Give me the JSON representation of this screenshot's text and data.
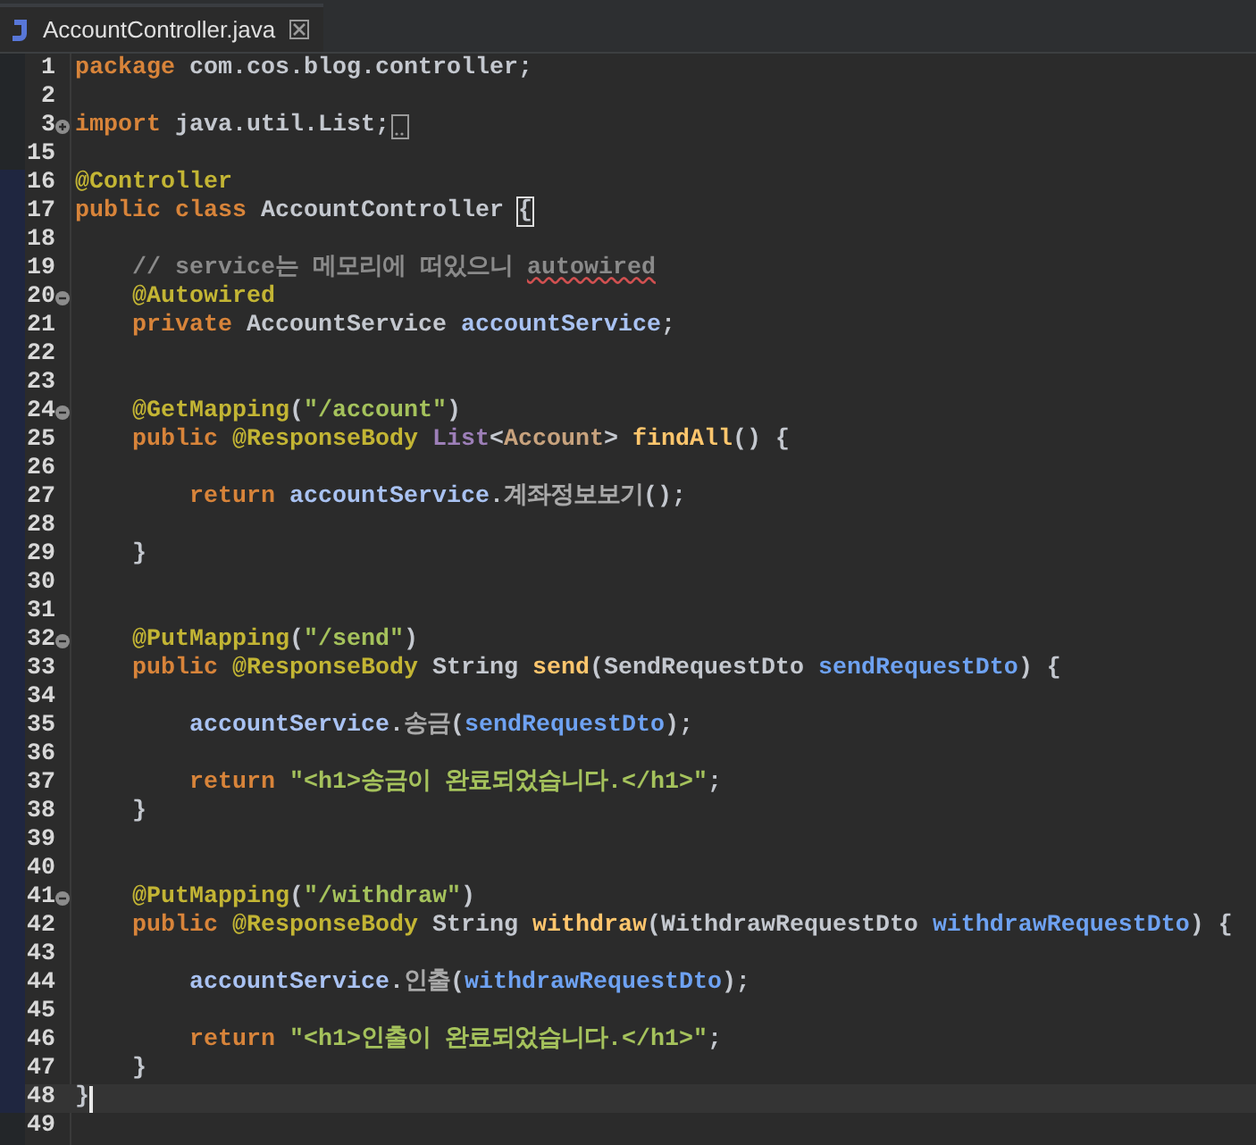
{
  "tab": {
    "title": "AccountController.java",
    "selected": true
  },
  "lines": [
    {
      "number": "1",
      "changed": false,
      "current": false,
      "tokens": [
        {
          "kind": "keyword",
          "text": "package"
        },
        {
          "kind": "plain",
          "text": " com.cos.blog.controller;"
        }
      ]
    },
    {
      "number": "2",
      "changed": false,
      "current": false
    },
    {
      "number": "3",
      "changed": false,
      "current": false,
      "folded": true,
      "tokens": [
        {
          "kind": "keyword",
          "text": "import"
        },
        {
          "kind": "plain",
          "text": " java.util.List;"
        }
      ]
    },
    {
      "number": "15",
      "changed": false,
      "current": false
    },
    {
      "number": "16",
      "changed": true,
      "current": false,
      "tokens": [
        {
          "kind": "annotation",
          "text": "@Controller"
        }
      ]
    },
    {
      "number": "17",
      "changed": true,
      "current": false,
      "tokens": [
        {
          "kind": "keyword",
          "text": "public"
        },
        {
          "kind": "keyword",
          "text": " class"
        },
        {
          "kind": "plain",
          "text": " AccountController "
        },
        {
          "kind": "bracket",
          "text": "{"
        }
      ]
    },
    {
      "number": "18",
      "changed": true,
      "current": false
    },
    {
      "number": "19",
      "changed": true,
      "current": false,
      "tokens": [
        {
          "kind": "comment",
          "text": "    // service는 메모리에 떠있으니 "
        },
        {
          "kind": "misspelled",
          "text": "autowired"
        }
      ]
    },
    {
      "number": "20",
      "changed": true,
      "current": false,
      "folded": false,
      "tokens": [
        {
          "kind": "annotation",
          "text": "    @Autowired"
        }
      ]
    },
    {
      "number": "21",
      "changed": true,
      "current": false,
      "tokens": [
        {
          "kind": "keyword",
          "text": "    private"
        },
        {
          "kind": "plain",
          "text": " AccountService "
        },
        {
          "kind": "field",
          "text": "accountService"
        },
        {
          "kind": "plain",
          "text": ";"
        }
      ]
    },
    {
      "number": "22",
      "changed": true,
      "current": false
    },
    {
      "number": "23",
      "changed": true,
      "current": false
    },
    {
      "number": "24",
      "changed": true,
      "current": false,
      "folded": false,
      "tokens": [
        {
          "kind": "annotation",
          "text": "    @GetMapping"
        },
        {
          "kind": "plain",
          "text": "("
        },
        {
          "kind": "string",
          "text": "\"/account\""
        },
        {
          "kind": "plain",
          "text": ")"
        }
      ]
    },
    {
      "number": "25",
      "changed": true,
      "current": false,
      "tokens": [
        {
          "kind": "keyword",
          "text": "    public"
        },
        {
          "kind": "annotation",
          "text": " @ResponseBody"
        },
        {
          "kind": "interface",
          "text": " List"
        },
        {
          "kind": "plain",
          "text": "<"
        },
        {
          "kind": "typearg",
          "text": "Account"
        },
        {
          "kind": "plain",
          "text": "> "
        },
        {
          "kind": "method",
          "text": "findAll"
        },
        {
          "kind": "plain",
          "text": "() {"
        }
      ]
    },
    {
      "number": "26",
      "changed": true,
      "current": false
    },
    {
      "number": "27",
      "changed": true,
      "current": false,
      "tokens": [
        {
          "kind": "keyword",
          "text": "        return"
        },
        {
          "kind": "field",
          "text": " accountService"
        },
        {
          "kind": "plain",
          "text": "."
        },
        {
          "kind": "call",
          "text": "계좌정보보기"
        },
        {
          "kind": "plain",
          "text": "();"
        }
      ]
    },
    {
      "number": "28",
      "changed": true,
      "current": false
    },
    {
      "number": "29",
      "changed": true,
      "current": false,
      "tokens": [
        {
          "kind": "plain",
          "text": "    }"
        }
      ]
    },
    {
      "number": "30",
      "changed": true,
      "current": false
    },
    {
      "number": "31",
      "changed": true,
      "current": false
    },
    {
      "number": "32",
      "changed": true,
      "current": false,
      "folded": false,
      "tokens": [
        {
          "kind": "annotation",
          "text": "    @PutMapping"
        },
        {
          "kind": "plain",
          "text": "("
        },
        {
          "kind": "string",
          "text": "\"/send\""
        },
        {
          "kind": "plain",
          "text": ")"
        }
      ]
    },
    {
      "number": "33",
      "changed": true,
      "current": false,
      "tokens": [
        {
          "kind": "keyword",
          "text": "    public"
        },
        {
          "kind": "annotation",
          "text": " @ResponseBody"
        },
        {
          "kind": "plain",
          "text": " String "
        },
        {
          "kind": "method",
          "text": "send"
        },
        {
          "kind": "plain",
          "text": "(SendRequestDto "
        },
        {
          "kind": "param",
          "text": "sendRequestDto"
        },
        {
          "kind": "plain",
          "text": ") {"
        }
      ]
    },
    {
      "number": "34",
      "changed": true,
      "current": false
    },
    {
      "number": "35",
      "changed": true,
      "current": false,
      "tokens": [
        {
          "kind": "field",
          "text": "        accountService"
        },
        {
          "kind": "plain",
          "text": "."
        },
        {
          "kind": "call",
          "text": "송금"
        },
        {
          "kind": "plain",
          "text": "("
        },
        {
          "kind": "param",
          "text": "sendRequestDto"
        },
        {
          "kind": "plain",
          "text": ");"
        }
      ]
    },
    {
      "number": "36",
      "changed": true,
      "current": false
    },
    {
      "number": "37",
      "changed": true,
      "current": false,
      "tokens": [
        {
          "kind": "keyword",
          "text": "        return"
        },
        {
          "kind": "string",
          "text": " \"<h1>송금이 완료되었습니다.</h1>\""
        },
        {
          "kind": "plain",
          "text": ";"
        }
      ]
    },
    {
      "number": "38",
      "changed": true,
      "current": false,
      "tokens": [
        {
          "kind": "plain",
          "text": "    }"
        }
      ]
    },
    {
      "number": "39",
      "changed": true,
      "current": false
    },
    {
      "number": "40",
      "changed": true,
      "current": false
    },
    {
      "number": "41",
      "changed": true,
      "current": false,
      "folded": false,
      "tokens": [
        {
          "kind": "annotation",
          "text": "    @PutMapping"
        },
        {
          "kind": "plain",
          "text": "("
        },
        {
          "kind": "string",
          "text": "\"/withdraw\""
        },
        {
          "kind": "plain",
          "text": ")"
        }
      ]
    },
    {
      "number": "42",
      "changed": true,
      "current": false,
      "tokens": [
        {
          "kind": "keyword",
          "text": "    public"
        },
        {
          "kind": "annotation",
          "text": " @ResponseBody"
        },
        {
          "kind": "plain",
          "text": " String "
        },
        {
          "kind": "method",
          "text": "withdraw"
        },
        {
          "kind": "plain",
          "text": "(WithdrawRequestDto "
        },
        {
          "kind": "param",
          "text": "withdrawRequestDto"
        },
        {
          "kind": "plain",
          "text": ") {"
        }
      ]
    },
    {
      "number": "43",
      "changed": true,
      "current": false
    },
    {
      "number": "44",
      "changed": true,
      "current": false,
      "tokens": [
        {
          "kind": "field",
          "text": "        accountService"
        },
        {
          "kind": "plain",
          "text": "."
        },
        {
          "kind": "call",
          "text": "인출"
        },
        {
          "kind": "plain",
          "text": "("
        },
        {
          "kind": "param",
          "text": "withdrawRequestDto"
        },
        {
          "kind": "plain",
          "text": ");"
        }
      ]
    },
    {
      "number": "45",
      "changed": true,
      "current": false
    },
    {
      "number": "46",
      "changed": true,
      "current": false,
      "tokens": [
        {
          "kind": "keyword",
          "text": "        return"
        },
        {
          "kind": "string",
          "text": " \"<h1>인출이 완료되었습니다.</h1>\""
        },
        {
          "kind": "plain",
          "text": ";"
        }
      ]
    },
    {
      "number": "47",
      "changed": true,
      "current": false,
      "tokens": [
        {
          "kind": "plain",
          "text": "    }"
        }
      ]
    },
    {
      "number": "48",
      "changed": true,
      "current": true,
      "tokens": [
        {
          "kind": "plain",
          "text": "}"
        }
      ]
    },
    {
      "number": "49",
      "changed": false,
      "current": false
    }
  ]
}
